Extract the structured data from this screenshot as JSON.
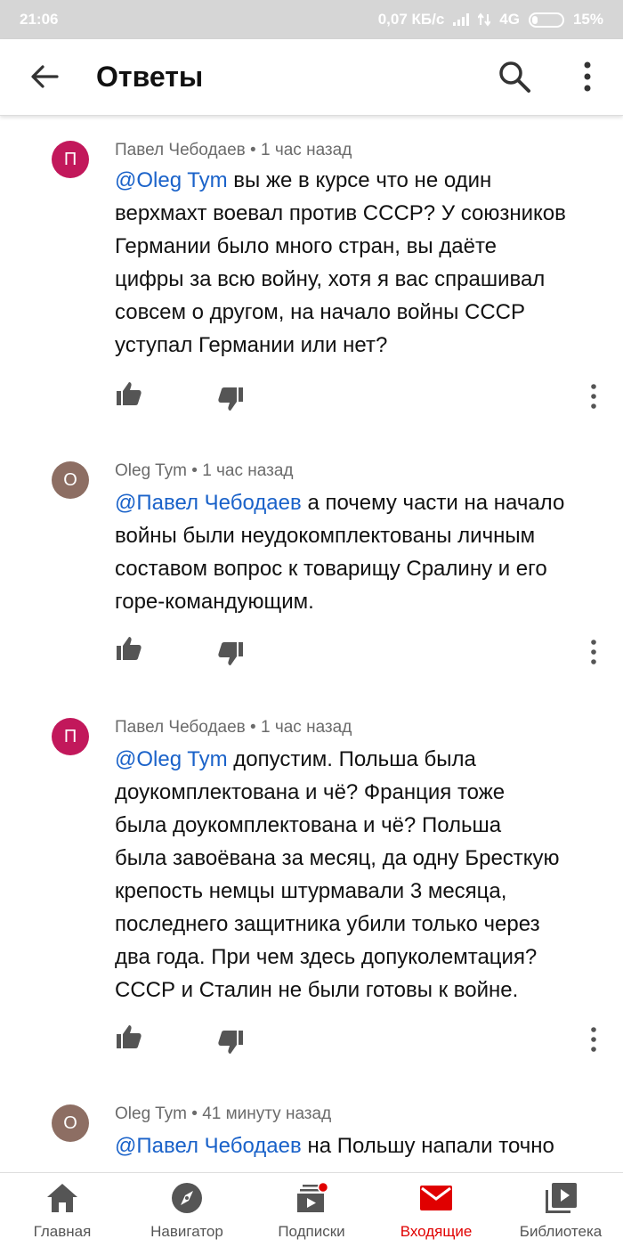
{
  "status_bar": {
    "time": "21:06",
    "speed": "0,07 КБ/с",
    "network": "4G",
    "battery": "15%"
  },
  "header": {
    "title": "Ответы"
  },
  "comments": [
    {
      "avatar_letter": "П",
      "avatar_color": "#c2185b",
      "author": "Павел Чебодаев",
      "time": "1 час назад",
      "mention": "@Oleg Tym",
      "lines": [
        "вы же в курсе что не один",
        "верхмахт воевал против СССР? У союзников",
        "Германии было много стран, вы даёте",
        "цифры за всю войну, хотя я вас спрашивал",
        "совсем о другом, на начало войны СССР",
        "уступал Германии или нет?"
      ]
    },
    {
      "avatar_letter": "O",
      "avatar_color": "#8d6e63",
      "author": "Oleg Tym",
      "time": "1 час назад",
      "mention": "@Павел Чебодаев",
      "lines": [
        "а почему части на начало",
        "войны были неудокомплектованы личным",
        "составом вопрос к товарищу Сралину и его",
        "горе-командующим."
      ]
    },
    {
      "avatar_letter": "П",
      "avatar_color": "#c2185b",
      "author": "Павел Чебодаев",
      "time": "1 час назад",
      "mention": "@Oleg Tym",
      "lines": [
        "допустим. Польша была",
        "доукомплектована и чё? Франция тоже",
        "была доукомплектована и чё? Польша",
        "была завоёвана за месяц, да одну Бресткую",
        "крепость немцы штурмавали 3 месяца,",
        "последнего защитника убили только через",
        "два года. При чем здесь допуколемтация?",
        "СССР и Сталин не были готовы к войне."
      ]
    },
    {
      "avatar_letter": "O",
      "avatar_color": "#8d6e63",
      "author": "Oleg Tym",
      "time": "41 минуту назад",
      "mention": "@Павел Чебодаев",
      "lines": [
        "на Польшу напали точно"
      ]
    }
  ],
  "nav": [
    {
      "label": "Главная",
      "icon": "home-icon"
    },
    {
      "label": "Навигатор",
      "icon": "compass-icon"
    },
    {
      "label": "Подписки",
      "icon": "subscriptions-icon"
    },
    {
      "label": "Входящие",
      "icon": "inbox-icon"
    },
    {
      "label": "Библиотека",
      "icon": "library-icon"
    }
  ],
  "colors": {
    "accent": "#e00000",
    "mention": "#1a62c9",
    "status_bar": "#d6d6d6"
  }
}
